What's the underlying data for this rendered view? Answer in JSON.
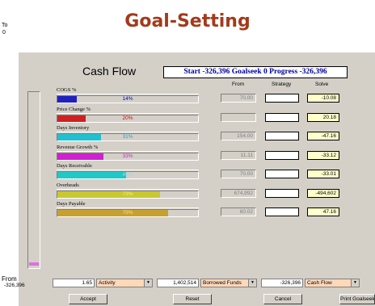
{
  "heading": "Goal-Setting",
  "panel": {
    "to_label": "To",
    "to_value": "0",
    "from_label": "From",
    "from_value": "-326,396",
    "title": "Cash Flow",
    "summary": "Start -326,396  Goalseek  0  Progress  -326,396",
    "column_headers": {
      "from": "From",
      "strategy": "Strategy",
      "solve": "Solve"
    },
    "rows": [
      {
        "label": "COGS %",
        "pct": "14%",
        "fill": 0.14,
        "bar_color": "#2020c0",
        "pct_color": "#0000c0",
        "from": "70.00",
        "strategy": "",
        "solve": "-10.08"
      },
      {
        "label": "Price Change %",
        "pct": "20%",
        "fill": 0.2,
        "bar_color": "#d02020",
        "pct_color": "#e00000",
        "from": "",
        "strategy": "",
        "solve": "20.18"
      },
      {
        "label": "Days Inventory",
        "pct": "31%",
        "fill": 0.31,
        "bar_color": "#20c0d0",
        "pct_color": "#20a0d0",
        "from": "154.00",
        "strategy": "",
        "solve": "-47.16"
      },
      {
        "label": "Revenue Growth %",
        "pct": "33%",
        "fill": 0.33,
        "bar_color": "#d020d0",
        "pct_color": "#d020d0",
        "from": "11.11",
        "strategy": "",
        "solve": "-33.12"
      },
      {
        "label": "Days Receivable",
        "pct": "49%",
        "fill": 0.49,
        "bar_color": "#20c8c8",
        "pct_color": "#90e0e0",
        "from": "70.00",
        "strategy": "",
        "solve": "-33.01"
      },
      {
        "label": "Overheads",
        "pct": "73%",
        "fill": 0.73,
        "bar_color": "#c8c830",
        "pct_color": "#f0f080",
        "from": "674,992",
        "strategy": "",
        "solve": "-494,602"
      },
      {
        "label": "Days Payable",
        "pct": "79%",
        "fill": 0.79,
        "bar_color": "#c8a030",
        "pct_color": "#f0e080",
        "from": "60.02",
        "strategy": "",
        "solve": "47.16"
      }
    ],
    "bottom": {
      "value1": "1.65",
      "select1": "Activity",
      "value2": "1,402,514",
      "select2": "Borrowed Funds",
      "value3": "-326,396",
      "select3": "Cash Flow"
    },
    "buttons": {
      "accept": "Accept",
      "reset": "Reset",
      "cancel": "Cancel",
      "print": "Print Goalseek"
    },
    "arrow_glyph": "▼"
  }
}
